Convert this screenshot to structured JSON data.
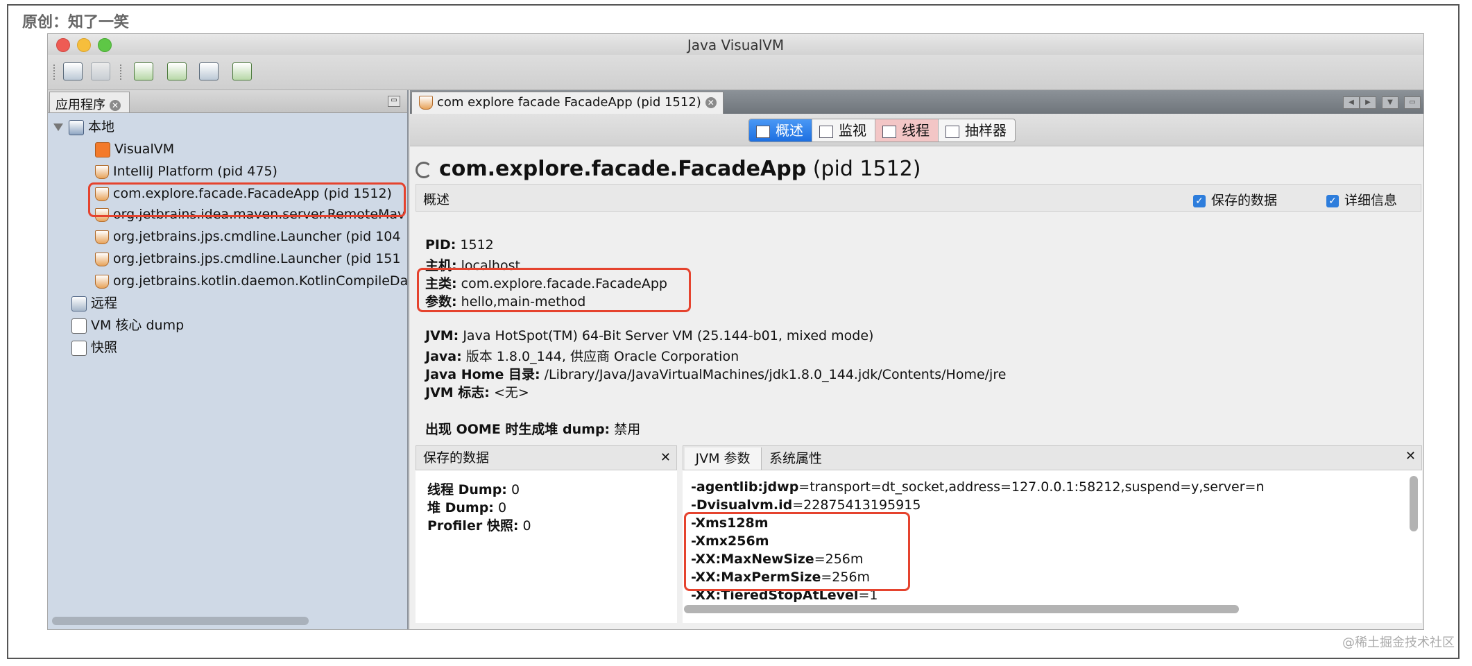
{
  "attribution": "原创：知了一笑",
  "watermark": "@稀土掘金技术社区",
  "window": {
    "title": "Java VisualVM"
  },
  "toolbar": {
    "icons": [
      "open-application-icon",
      "save-icon",
      "add-jmx-connection-icon",
      "add-coredump-icon",
      "add-snapshot-icon",
      "add-remote-host-icon"
    ]
  },
  "left_panel": {
    "tab_label": "应用程序",
    "tree": {
      "local": "本地",
      "apps": [
        "VisualVM",
        "IntelliJ Platform (pid 475)",
        "com.explore.facade.FacadeApp (pid 1512)",
        "org.jetbrains.idea.maven.server.RemoteMav",
        "org.jetbrains.jps.cmdline.Launcher (pid 104",
        "org.jetbrains.jps.cmdline.Launcher (pid 151",
        "org.jetbrains.kotlin.daemon.KotlinCompileDa"
      ],
      "remote": "远程",
      "core_dump": "VM 核心 dump",
      "snapshots": "快照"
    }
  },
  "document_tab": {
    "label": "com explore facade FacadeApp (pid 1512)"
  },
  "views": {
    "overview": "概述",
    "monitor": "监视",
    "threads": "线程",
    "sampler": "抽样器"
  },
  "heading": {
    "name": "com.explore.facade.FacadeApp",
    "pid": "(pid 1512)"
  },
  "overview": {
    "label": "概述",
    "saved_data_checkbox": "保存的数据",
    "details_checkbox": "详细信息",
    "pid_label": "PID:",
    "pid": "1512",
    "host_label": "主机:",
    "host": "localhost",
    "main_class_label": "主类:",
    "main_class": "com.explore.facade.FacadeApp",
    "args_label": "参数:",
    "args": "hello,main-method",
    "jvm_label": "JVM:",
    "jvm": "Java HotSpot(TM) 64-Bit Server VM (25.144-b01, mixed mode)",
    "java_label": "Java:",
    "java": "版本 1.8.0_144, 供应商 Oracle Corporation",
    "java_home_label": "Java Home 目录:",
    "java_home": "/Library/Java/JavaVirtualMachines/jdk1.8.0_144.jdk/Contents/Home/jre",
    "jvm_flags_label": "JVM 标志:",
    "jvm_flags": "<无>",
    "oome_label": "出现 OOME 时生成堆 dump:",
    "oome": "禁用"
  },
  "saved_data": {
    "header": "保存的数据",
    "thread_dump_label": "线程 Dump:",
    "thread_dump": "0",
    "heap_dump_label": "堆 Dump:",
    "heap_dump": "0",
    "profiler_label": "Profiler 快照:",
    "profiler": "0"
  },
  "jvm_args_pane": {
    "tab_jvm_args": "JVM 参数",
    "tab_sys_props": "系统属性",
    "args": [
      {
        "name": "-agentlib:jdwp",
        "value": "=transport=dt_socket,address=127.0.0.1:58212,suspend=y,server=n"
      },
      {
        "name": "-Dvisualvm.id",
        "value": "=22875413195915"
      },
      {
        "name": "-Xms128m",
        "value": ""
      },
      {
        "name": "-Xmx256m",
        "value": ""
      },
      {
        "name": "-XX:MaxNewSize",
        "value": "=256m"
      },
      {
        "name": "-XX:MaxPermSize",
        "value": "=256m"
      },
      {
        "name": "-XX:TieredStopAtLevel",
        "value": "=1"
      }
    ]
  },
  "colors": {
    "highlight_box": "#e5432e",
    "active_view": "#1d6fe0"
  }
}
